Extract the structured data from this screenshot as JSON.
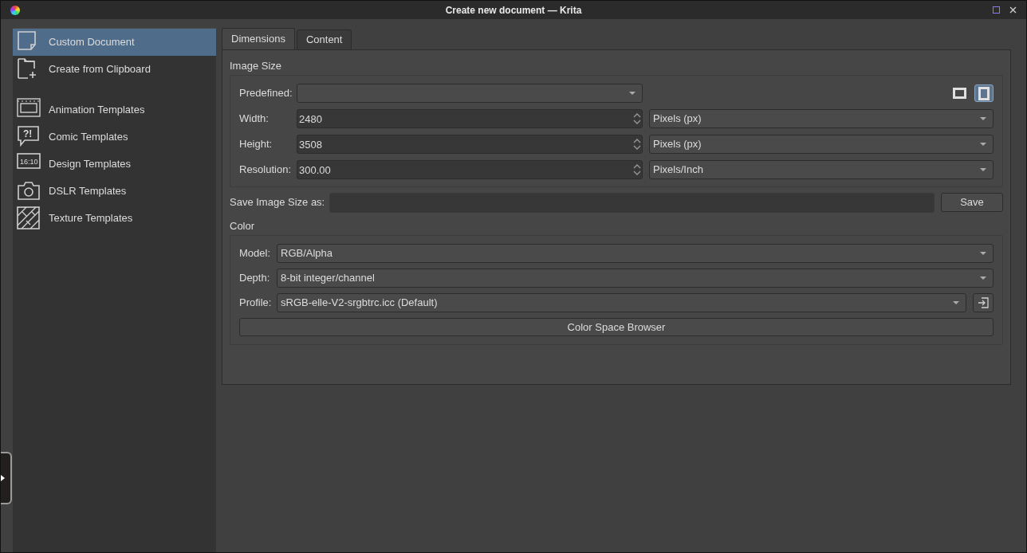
{
  "window": {
    "title": "Create new document — Krita"
  },
  "sidebar": {
    "documents": [
      {
        "label": "Custom Document",
        "kind": "page",
        "selected": true
      },
      {
        "label": "Create from Clipboard",
        "kind": "clipboard",
        "selected": false
      }
    ],
    "templates": [
      {
        "label": "Animation Templates",
        "kind": "animation",
        "selected": false
      },
      {
        "label": "Comic Templates",
        "kind": "comic",
        "icon_text": "?!",
        "selected": false
      },
      {
        "label": "Design Templates",
        "kind": "design",
        "icon_text": "16:10",
        "selected": false
      },
      {
        "label": "DSLR Templates",
        "kind": "camera",
        "selected": false
      },
      {
        "label": "Texture Templates",
        "kind": "texture",
        "selected": false
      }
    ]
  },
  "tabs": [
    {
      "label": "Dimensions",
      "selected": true
    },
    {
      "label": "Content",
      "selected": false
    }
  ],
  "image_size": {
    "title": "Image Size",
    "predefined": {
      "label": "Predefined:"
    },
    "orientation": [
      {
        "kind": "landscape",
        "selected": false
      },
      {
        "kind": "portrait",
        "selected": true
      }
    ],
    "rows": [
      {
        "label": "Width:",
        "value": "2480",
        "unit": "Pixels (px)"
      },
      {
        "label": "Height:",
        "value": "3508",
        "unit": "Pixels (px)"
      },
      {
        "label": "Resolution:",
        "value": "300.00",
        "unit": "Pixels/Inch"
      }
    ],
    "save_as": {
      "label": "Save Image Size as:",
      "button": "Save"
    }
  },
  "color": {
    "title": "Color",
    "rows": [
      {
        "label": "Model:",
        "value": "RGB/Alpha",
        "kind": "combo"
      },
      {
        "label": "Depth:",
        "value": "8-bit integer/channel",
        "kind": "combo"
      },
      {
        "label": "Profile:",
        "value": "sRGB-elle-V2-srgbtrc.icc (Default)",
        "kind": "profile"
      }
    ],
    "browser_button": "Color Space Browser"
  }
}
